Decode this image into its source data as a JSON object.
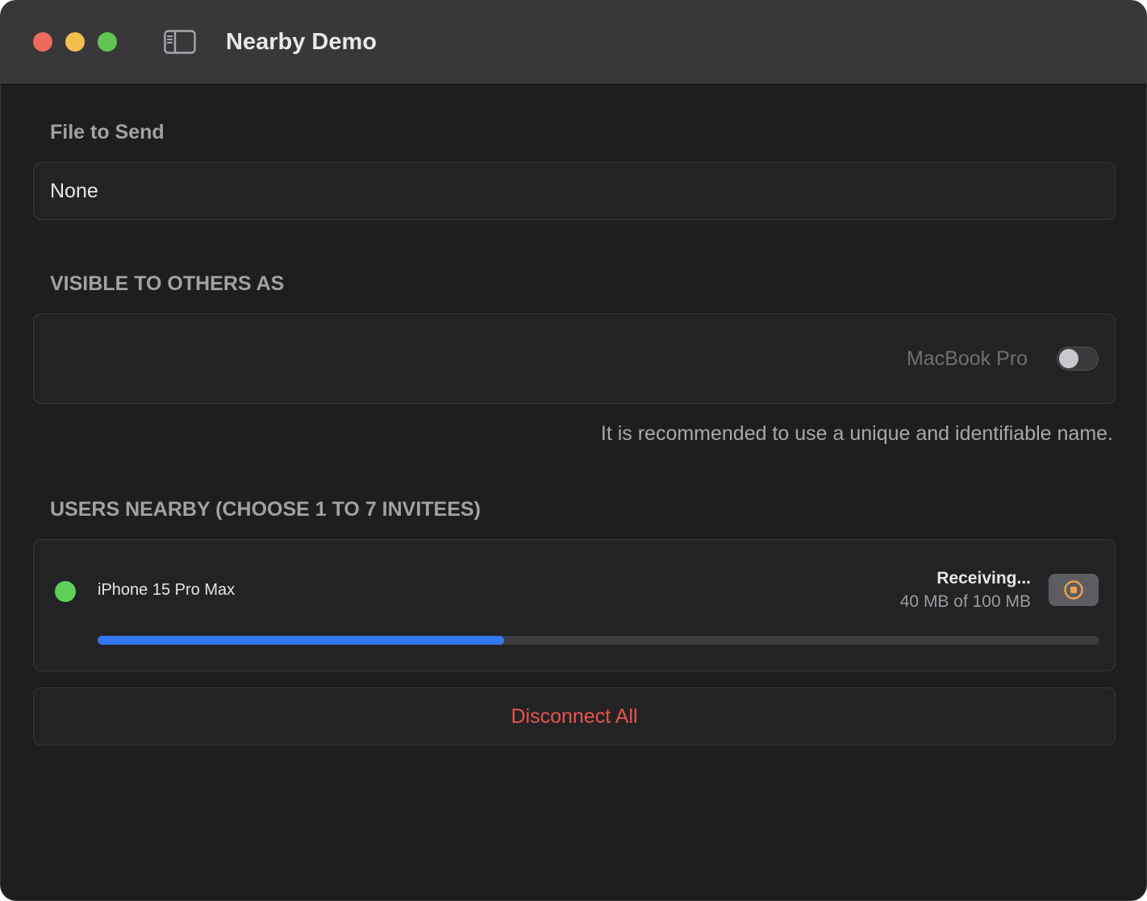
{
  "window": {
    "title": "Nearby Demo"
  },
  "icons": {
    "close": "close-traffic-light",
    "minimize": "minimize-traffic-light",
    "zoom": "zoom-traffic-light",
    "sidebar_toggle": "sidebar-left-icon",
    "stop": "stop-circle-icon",
    "status": "online-status-dot"
  },
  "colors": {
    "close": "#ee6a5f",
    "minimize": "#f5be4f",
    "zoom": "#61c554",
    "online": "#5fd15a",
    "progress": "#3478f0",
    "stop_accent": "#f0a04b",
    "destructive": "#e8544a"
  },
  "file_section": {
    "header": "File to Send",
    "value": "None"
  },
  "visibility_section": {
    "header": "VISIBLE TO OTHERS AS",
    "device_name": "MacBook Pro",
    "toggle_on": false,
    "hint": "It is recommended to use a unique and identifiable name."
  },
  "users_section": {
    "header": "USERS NEARBY (CHOOSE 1 TO 7 INVITEES)",
    "peers": [
      {
        "name": "iPhone 15 Pro Max",
        "online": true,
        "status": "Receiving...",
        "progress_text": "40 MB of 100 MB",
        "progress_fraction": 0.406
      }
    ]
  },
  "actions": {
    "disconnect_all": "Disconnect All"
  }
}
